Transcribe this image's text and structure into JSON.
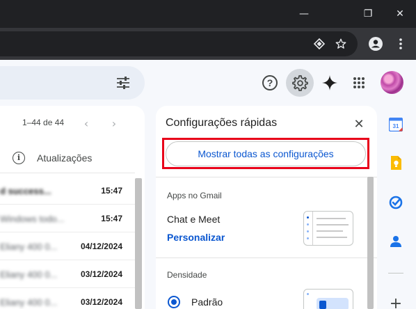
{
  "browser": {
    "window_controls": {
      "minimize": "—",
      "restore": "❐",
      "close": "✕"
    },
    "toolbar_icons": [
      "extension-icon",
      "star-icon",
      "profile-icon",
      "kebab-menu-icon"
    ]
  },
  "header": {
    "icons": [
      "filter-sliders-icon",
      "help-icon",
      "settings-gear-icon",
      "gemini-sparkle-icon",
      "apps-grid-icon"
    ],
    "help_glyph": "?",
    "active_icon": "settings-gear-icon"
  },
  "mail_list": {
    "pager_text": "1–44 de 44",
    "tab_label": "Atualizações",
    "rows": [
      {
        "sender": "d success...",
        "date": "15:47",
        "unread": true
      },
      {
        "sender": "Windows todo...",
        "date": "15:47",
        "unread": false
      },
      {
        "sender": "Eliany 400 0...",
        "date": "04/12/2024",
        "unread": false
      },
      {
        "sender": "Eliany 400 0...",
        "date": "03/12/2024",
        "unread": false
      },
      {
        "sender": "Eliany 400 0...",
        "date": "03/12/2024",
        "unread": false
      }
    ]
  },
  "quick_settings": {
    "title": "Configurações rápidas",
    "close_glyph": "✕",
    "show_all_button": "Mostrar todas as configurações",
    "apps_section": "Apps no Gmail",
    "chat_meet_label": "Chat e Meet",
    "customize_link": "Personalizar",
    "density_section": "Densidade",
    "density_default_label": "Padrão",
    "density_default_selected": true
  },
  "side_panel": {
    "apps": [
      "google-calendar-icon",
      "google-keep-icon",
      "google-tasks-icon",
      "google-contacts-icon"
    ],
    "calendar_day": "31",
    "add_glyph": "+"
  },
  "colors": {
    "accent_blue": "#0b57d0",
    "highlight_red": "#e8001a",
    "chrome_dark": "#202124"
  }
}
